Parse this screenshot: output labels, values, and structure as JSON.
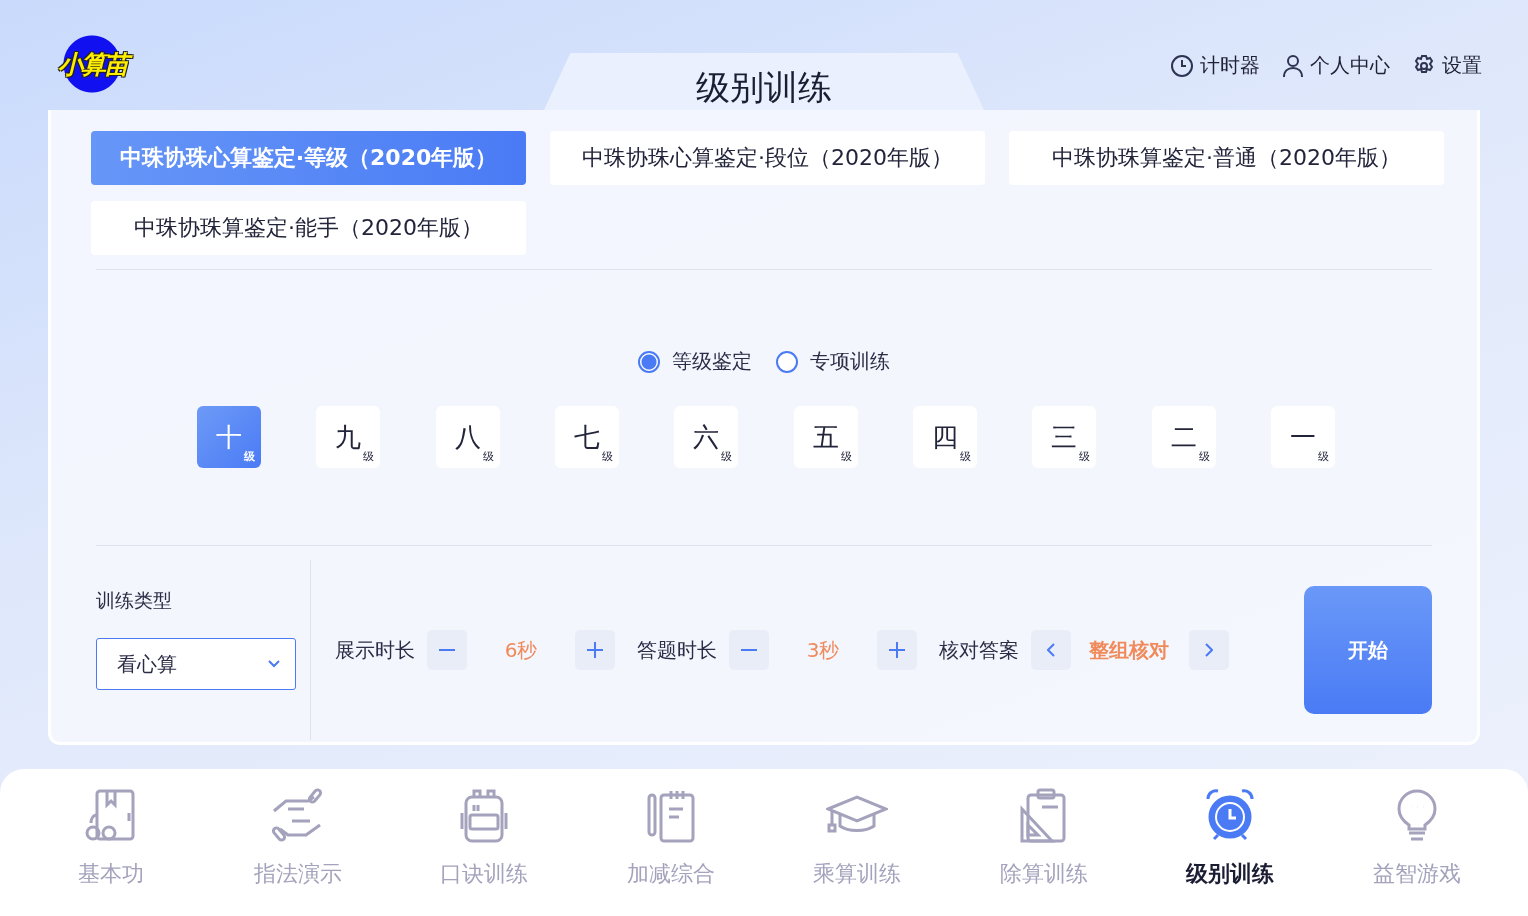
{
  "logo": {
    "text": "小算苗"
  },
  "page_title": "级别训练",
  "top_links": [
    {
      "label": "计时器",
      "kind": "timer"
    },
    {
      "label": "个人中心",
      "kind": "user"
    },
    {
      "label": "设置",
      "kind": "settings"
    }
  ],
  "categories": [
    {
      "label": "中珠协珠心算鉴定·等级（2020年版）",
      "selected": true
    },
    {
      "label": "中珠协珠心算鉴定·段位（2020年版）",
      "selected": false
    },
    {
      "label": "中珠协珠算鉴定·普通（2020年版）",
      "selected": false
    },
    {
      "label": "中珠协珠算鉴定·能手（2020年版）",
      "selected": false
    }
  ],
  "modes": [
    {
      "label": "等级鉴定",
      "selected": true
    },
    {
      "label": "专项训练",
      "selected": false
    }
  ],
  "levels": [
    {
      "label": "十",
      "unit": "级",
      "selected": true
    },
    {
      "label": "九",
      "unit": "级",
      "selected": false
    },
    {
      "label": "八",
      "unit": "级",
      "selected": false
    },
    {
      "label": "七",
      "unit": "级",
      "selected": false
    },
    {
      "label": "六",
      "unit": "级",
      "selected": false
    },
    {
      "label": "五",
      "unit": "级",
      "selected": false
    },
    {
      "label": "四",
      "unit": "级",
      "selected": false
    },
    {
      "label": "三",
      "unit": "级",
      "selected": false
    },
    {
      "label": "二",
      "unit": "级",
      "selected": false
    },
    {
      "label": "一",
      "unit": "级",
      "selected": false
    }
  ],
  "training_type": {
    "label": "训练类型",
    "value": "看心算"
  },
  "settings": [
    {
      "kind": "stepper",
      "label": "展示时长",
      "value": "6秒"
    },
    {
      "kind": "stepper",
      "label": "答题时长",
      "value": "3秒"
    },
    {
      "kind": "switcher",
      "label": "核对答案",
      "value": "整组核对"
    }
  ],
  "start_button": "开始",
  "nav": [
    {
      "label": "基本功",
      "kind": "book",
      "selected": false
    },
    {
      "label": "指法演示",
      "kind": "hands",
      "selected": false
    },
    {
      "label": "口诀训练",
      "kind": "backpack",
      "selected": false
    },
    {
      "label": "加减综合",
      "kind": "notebook",
      "selected": false
    },
    {
      "label": "乘算训练",
      "kind": "cap",
      "selected": false
    },
    {
      "label": "除算训练",
      "kind": "clipboard",
      "selected": false
    },
    {
      "label": "级别训练",
      "kind": "clock",
      "selected": true
    },
    {
      "label": "益智游戏",
      "kind": "bulb",
      "selected": false
    }
  ]
}
